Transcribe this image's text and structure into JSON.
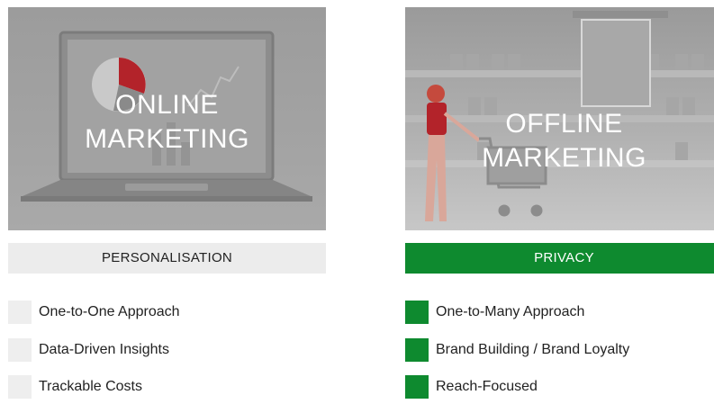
{
  "panels": {
    "left": {
      "title_lines": [
        "ONLINE",
        "MARKETING"
      ],
      "banner": "PERSONALISATION",
      "items": [
        "One-to-One Approach",
        "Data-Driven Insights",
        "Trackable Costs"
      ],
      "colors": {
        "square": "#eeeeee",
        "banner_bg": "#ececec"
      }
    },
    "right": {
      "title_lines": [
        "OFFLINE",
        "MARKETING"
      ],
      "banner": "PRIVACY",
      "items": [
        "One-to-Many Approach",
        "Brand Building / Brand Loyalty",
        "Reach-Focused"
      ],
      "colors": {
        "square": "#0e8a2f",
        "banner_bg": "#0e8a2f"
      }
    }
  }
}
